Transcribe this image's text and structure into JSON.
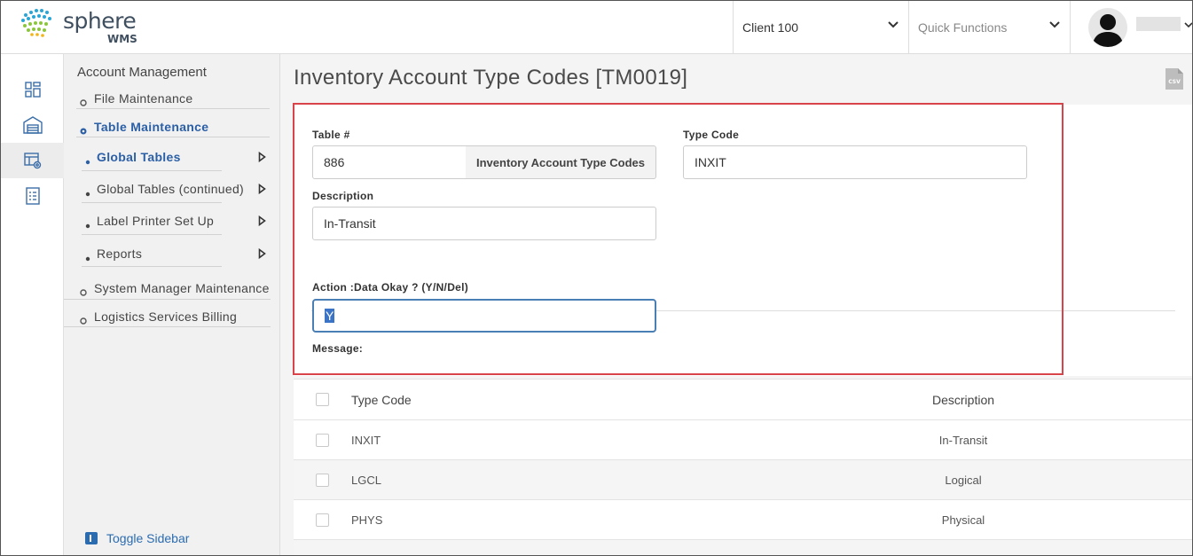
{
  "header": {
    "logo_main": "sphere",
    "logo_sub": "WMS",
    "client_selector": "Client 100",
    "quick_functions_placeholder": "Quick Functions"
  },
  "sidebar": {
    "section_title": "Account Management",
    "items": [
      {
        "label": "File Maintenance"
      },
      {
        "label": "Table Maintenance"
      },
      {
        "label": "Global Tables"
      },
      {
        "label": "Global Tables (continued)"
      },
      {
        "label": "Label Printer Set Up"
      },
      {
        "label": "Reports"
      },
      {
        "label": "System Manager Maintenance"
      },
      {
        "label": "Logistics Services Billing"
      }
    ],
    "toggle_label": "Toggle Sidebar"
  },
  "main": {
    "title": "Inventory Account Type Codes [TM0019]",
    "csv_label": "CSV",
    "form": {
      "table_num_label": "Table #",
      "table_num_value": "886",
      "table_name": "Inventory Account Type Codes",
      "type_code_label": "Type Code",
      "type_code_value": "INXIT",
      "description_label": "Description",
      "description_value": "In-Transit",
      "action_label": "Action :Data Okay ? (Y/N/Del)",
      "action_value": "Y",
      "message_label": "Message:"
    },
    "grid": {
      "columns": [
        "Type Code",
        "Description"
      ],
      "rows": [
        {
          "code": "INXIT",
          "description": "In-Transit"
        },
        {
          "code": "LGCL",
          "description": "Logical"
        },
        {
          "code": "PHYS",
          "description": "Physical"
        }
      ]
    }
  },
  "colors": {
    "accent": "#2b5fa6",
    "highlight": "#d9434a",
    "focus_border": "#4a7fb5"
  }
}
